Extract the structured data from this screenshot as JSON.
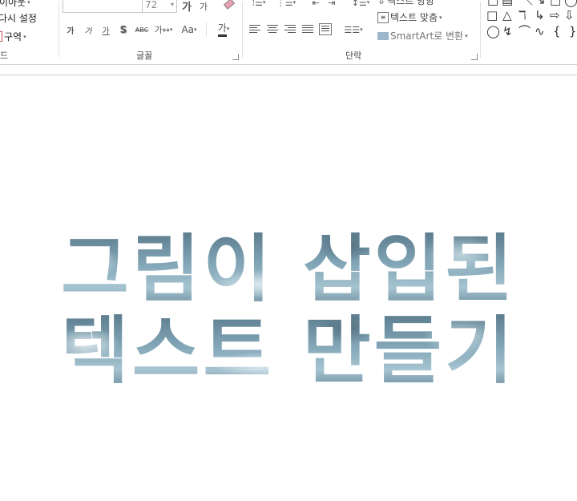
{
  "ribbon": {
    "clipboard": {
      "layout_label": "레이아웃",
      "reset_label": "다시 설정",
      "section_label": "구역",
      "group_label": "드"
    },
    "font": {
      "font_size": "72",
      "group_label": "글꼴",
      "grow_label": "가",
      "shrink_label": "가",
      "bold_label": "가",
      "italic_label": "가",
      "underline_label": "가",
      "shadow_label": "S",
      "strike_label": "ABC",
      "spacing_label": "가↔",
      "case_label": "Aa",
      "color_label": "가"
    },
    "paragraph": {
      "text_direction_label": "텍스트 방향",
      "align_text_label": "텍스트 맞춤",
      "smartart_label": "SmartArt로 변환",
      "group_label": "단락"
    },
    "drawing": {
      "shapes": [
        "□",
        "△",
        "ℸ",
        "↳",
        "⇨",
        "⇩",
        "◯",
        "↯",
        "⌒",
        "∿",
        "{",
        "}"
      ]
    }
  },
  "slide": {
    "line1": "그림이 삽입된",
    "line2": "텍스트 만들기"
  }
}
